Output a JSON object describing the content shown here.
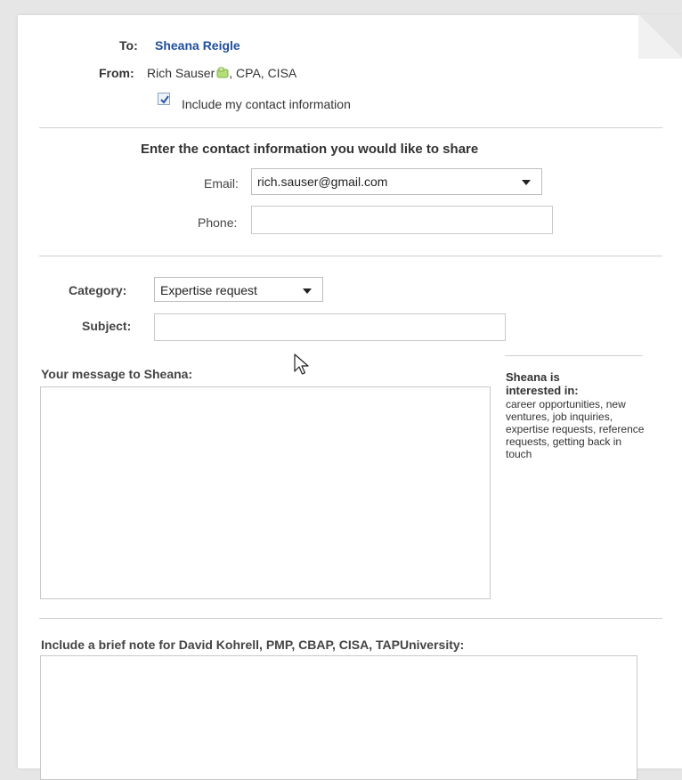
{
  "header": {
    "to_label": "To:",
    "to_name": "Sheana Reigle",
    "from_label": "From:",
    "from_name": "Rich Sauser",
    "from_suffix": ", CPA, CISA",
    "include_contact_label": "Include my contact information",
    "include_contact_checked": true
  },
  "contact": {
    "heading": "Enter the contact information you would like to share",
    "email_label": "Email:",
    "email_value": "rich.sauser@gmail.com",
    "phone_label": "Phone:",
    "phone_value": ""
  },
  "message": {
    "category_label": "Category:",
    "category_value": "Expertise request",
    "subject_label": "Subject:",
    "subject_value": "",
    "message_label": "Your message to Sheana:",
    "message_value": ""
  },
  "sidebar": {
    "interest_title": "Sheana is interested in:",
    "interest_list": "career opportunities, new ventures, job inquiries, expertise requests, reference requests, getting back in touch"
  },
  "note": {
    "label": "Include a brief note for David Kohrell, PMP, CBAP, CISA, TAPUniversity:",
    "value": ""
  },
  "colors": {
    "link": "#1f4f9c",
    "checkbox_check": "#2a56a6",
    "share_icon": "#8cc63f"
  }
}
